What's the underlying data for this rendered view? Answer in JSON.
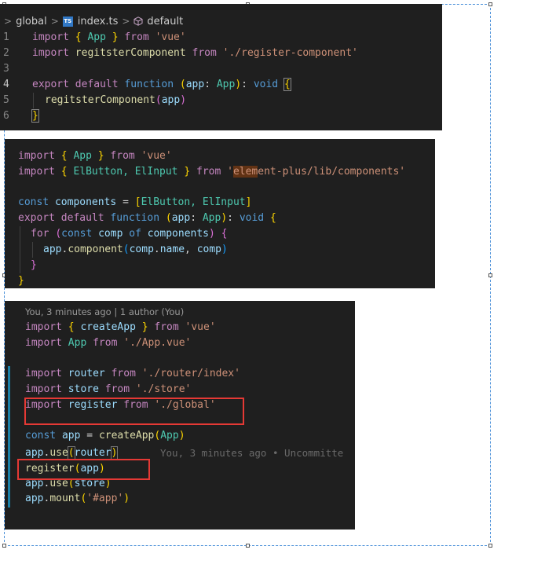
{
  "breadcrumb": {
    "folder": "global",
    "file": "index.ts",
    "ts_badge": "TS",
    "symbol": "default",
    "chevron": ">",
    "symbol_icon": "cube-icon"
  },
  "panel1": {
    "line_numbers": [
      "1",
      "2",
      "3",
      "4",
      "5",
      "6"
    ],
    "lines": {
      "l1": {
        "kw_import": "import",
        "br_open": "{",
        "id": "App",
        "br_close": "}",
        "kw_from": "from",
        "str": "'vue'"
      },
      "l2": {
        "kw_import": "import",
        "id": "regitsterComponent",
        "kw_from": "from",
        "str": "'./register-component'"
      },
      "l4": {
        "kw_export": "export",
        "kw_default": "default",
        "kw_function": "function",
        "p_open": "(",
        "param": "app",
        "colon": ":",
        "type": "App",
        "p_close": ")",
        "colon2": ":",
        "ret": "void",
        "brace": "{"
      },
      "l5": {
        "fn": "regitsterComponent",
        "p_open": "(",
        "arg": "app",
        "p_close": ")"
      },
      "l6": {
        "brace": "}"
      }
    }
  },
  "panel2": {
    "lines": {
      "l1": {
        "kw_import": "import",
        "br_open": "{",
        "id": "App",
        "br_close": "}",
        "kw_from": "from",
        "str": "'vue'"
      },
      "l2": {
        "kw_import": "import",
        "br_open": "{",
        "id": "ElButton, ElInput",
        "br_close": "}",
        "kw_from": "from",
        "str_q": "'",
        "str_hl": "elem",
        "str_rest": "ent-plus/lib/components'"
      },
      "l4": {
        "kw_const": "const",
        "var": "components",
        "eq": "=",
        "b_open": "[",
        "items": "ElButton, ElInput",
        "b_close": "]"
      },
      "l5": {
        "kw_export": "export",
        "kw_default": "default",
        "kw_function": "function",
        "p_open": "(",
        "param": "app",
        "colon": ":",
        "type": "App",
        "p_close": ")",
        "colon2": ":",
        "ret": "void",
        "brace": "{"
      },
      "l6": {
        "kw_for": "for",
        "p_open": "(",
        "kw_const": "const",
        "var": "comp",
        "kw_of": "of",
        "iter": "components",
        "p_close": ")",
        "brace": "{"
      },
      "l7": {
        "obj": "app",
        "dot": ".",
        "fn": "component",
        "p_open": "(",
        "a1": "comp",
        "dot2": ".",
        "a1p": "name",
        "comma": ",",
        "a2": "comp",
        "p_close": ")"
      },
      "l8": {
        "brace": "}"
      },
      "l9": {
        "brace": "}"
      }
    }
  },
  "panel3": {
    "blame_header": "You, 3 minutes ago | 1 author (You)",
    "inline_blame": "You, 3 minutes ago • Uncommitte",
    "lines": {
      "l1": {
        "kw_import": "import",
        "br_open": "{",
        "id": "createApp",
        "br_close": "}",
        "kw_from": "from",
        "str": "'vue'"
      },
      "l2": {
        "kw_import": "import",
        "id": "App",
        "kw_from": "from",
        "str": "'./App.vue'"
      },
      "l4": {
        "kw_import": "import",
        "id": "router",
        "kw_from": "from",
        "str": "'./router/index'"
      },
      "l5": {
        "kw_import": "import",
        "id": "store",
        "kw_from": "from",
        "str": "'./store'"
      },
      "l6": {
        "kw_import": "import",
        "id": "register",
        "kw_from": "from",
        "str": "'./global'"
      },
      "l8": {
        "kw_const": "const",
        "var": "app",
        "eq": "=",
        "fn": "createApp",
        "p_open": "(",
        "arg": "App",
        "p_close": ")"
      },
      "l9": {
        "obj": "app",
        "dot": ".",
        "fn": "use",
        "p_open": "(",
        "arg": "router",
        "p_close": ")"
      },
      "l10": {
        "fn": "register",
        "p_open": "(",
        "arg": "app",
        "p_close": ")"
      },
      "l11": {
        "obj": "app",
        "dot": ".",
        "fn": "use",
        "p_open": "(",
        "arg": "store",
        "p_close": ")"
      },
      "l12": {
        "obj": "app",
        "dot": ".",
        "fn": "mount",
        "p_open": "(",
        "str": "'#app'",
        "p_close": ")"
      }
    }
  },
  "colors": {
    "editor_bg": "#1f1f1f",
    "keyword": "#c586c0",
    "storage": "#569cd6",
    "type": "#4ec9b0",
    "function": "#dcdcaa",
    "string": "#ce9178",
    "variable": "#9cdcfe",
    "annotation_box": "#e53935",
    "selection_frame": "#4a90d9"
  }
}
